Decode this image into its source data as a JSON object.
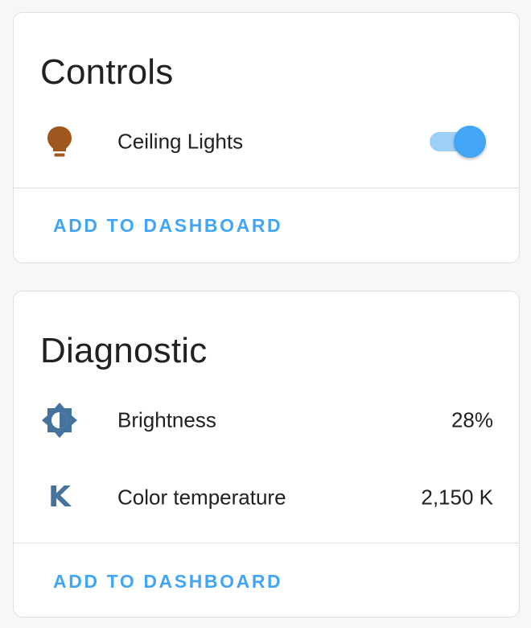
{
  "colors": {
    "accent": "#42a5f5",
    "accent_light": "#9fd0f7",
    "bulb": "#a0571d",
    "icon_blue": "#44739e"
  },
  "controls": {
    "title": "Controls",
    "entity": {
      "icon": "lightbulb-icon",
      "label": "Ceiling Lights",
      "state_on": true
    },
    "action_label": "ADD TO DASHBOARD"
  },
  "diagnostic": {
    "title": "Diagnostic",
    "rows": [
      {
        "icon": "brightness-icon",
        "label": "Brightness",
        "value": "28%"
      },
      {
        "icon": "kelvin-icon",
        "icon_glyph": "K",
        "label": "Color temperature",
        "value": "2,150 K"
      }
    ],
    "action_label": "ADD TO DASHBOARD"
  }
}
